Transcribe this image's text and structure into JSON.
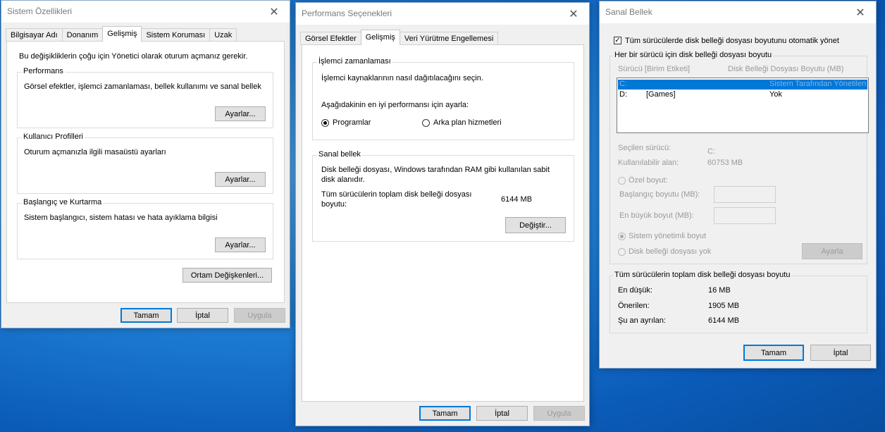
{
  "sys": {
    "title": "Sistem Özellikleri",
    "tabs": [
      "Bilgisayar Adı",
      "Donanım",
      "Gelişmiş",
      "Sistem Koruması",
      "Uzak"
    ],
    "admin_note": "Bu değişikliklerin çoğu için Yönetici olarak oturum açmanız gerekir.",
    "perf_label": "Performans",
    "perf_desc": "Görsel efektler, işlemci zamanlaması, bellek kullanımı ve sanal bellek",
    "settings_btn": "Ayarlar...",
    "profiles_label": "Kullanıcı Profilleri",
    "profiles_desc": "Oturum açmanızla ilgili masaüstü ayarları",
    "startup_label": "Başlangıç ve Kurtarma",
    "startup_desc": "Sistem başlangıcı, sistem hatası ve hata ayıklama bilgisi",
    "env_btn": "Ortam Değişkenleri...",
    "ok": "Tamam",
    "cancel": "İptal",
    "apply": "Uygula"
  },
  "perf": {
    "title": "Performans Seçenekleri",
    "tabs": [
      "Görsel Efektler",
      "Gelişmiş",
      "Veri Yürütme Engellemesi"
    ],
    "sched_label": "İşlemci zamanlaması",
    "sched_desc": "İşlemci kaynaklarının nasıl dağıtılacağını seçin.",
    "adjust_label": "Aşağıdakinin en iyi performansı için ayarla:",
    "programs": "Programlar",
    "background": "Arka plan hizmetleri",
    "vm_label": "Sanal bellek",
    "vm_desc1": "Disk belleği dosyası, Windows tarafından RAM gibi kullanılan sabit",
    "vm_desc2": "disk alanıdır.",
    "total_label1": "Tüm sürücülerin toplam disk belleği dosyası",
    "total_label2": "boyutu:",
    "total_value": "6144 MB",
    "change_btn": "Değiştir...",
    "ok": "Tamam",
    "cancel": "İptal",
    "apply": "Uygula"
  },
  "vm": {
    "title": "Sanal Bellek",
    "auto_manage": "Tüm sürücülerde disk belleği dosyası boyutunu otomatik yönet",
    "per_drive_label": "Her bir sürücü için disk belleği dosyası boyutu",
    "col_drive": "Sürücü  [Birim Etiketi]",
    "col_size": "Disk Belleği Dosyası Boyutu (MB)",
    "drives": [
      {
        "drive": "C:",
        "label": "",
        "size": "Sistem Tarafından Yönetilen"
      },
      {
        "drive": "D:",
        "label": "[Games]",
        "size": "Yok"
      }
    ],
    "selected_drive_label": "Seçilen sürücü:",
    "selected_drive_value": "C:",
    "available_label": "Kullanılabilir alan:",
    "available_value": "60753 MB",
    "custom_size": "Özel boyut:",
    "initial_size": "Başlangıç boyutu (MB):",
    "max_size": "En büyük boyut (MB):",
    "system_managed": "Sistem yönetimli boyut",
    "no_paging": "Disk belleği dosyası yok",
    "set_btn": "Ayarla",
    "total_label": "Tüm sürücülerin toplam disk belleği dosyası boyutu",
    "min_label": "En düşük:",
    "min_value": "16 MB",
    "rec_label": "Önerilen:",
    "rec_value": "1905 MB",
    "cur_label": "Şu an ayrılan:",
    "cur_value": "6144 MB",
    "ok": "Tamam",
    "cancel": "İptal"
  }
}
